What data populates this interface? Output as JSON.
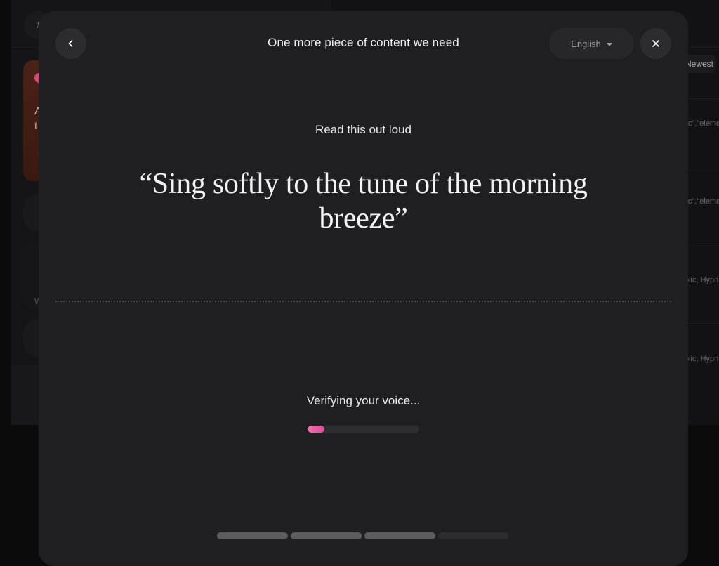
{
  "background": {
    "sort_label": "Newest",
    "card_text": "A\nt",
    "box_text": "W",
    "snippets": [
      "lic\",\"eleme",
      "lic\",\"eleme",
      "olic, Hypn",
      "olic, Hypn"
    ]
  },
  "modal": {
    "title": "One more piece of content we need",
    "language": {
      "selected": "English"
    },
    "instruction": "Read this out loud",
    "quote": "“Sing softly to the tune of the morning breeze”",
    "status_text": "Verifying your voice...",
    "progress_fraction": 0.15,
    "steps": [
      {
        "state": "done"
      },
      {
        "state": "done"
      },
      {
        "state": "done"
      },
      {
        "state": "todo"
      }
    ]
  },
  "colors": {
    "accent_pink": "#f36fb0",
    "modal_bg": "#1f1f22"
  },
  "icons": {
    "back": "chevron-left-icon",
    "close": "close-icon",
    "dropdown": "caret-down-icon"
  }
}
